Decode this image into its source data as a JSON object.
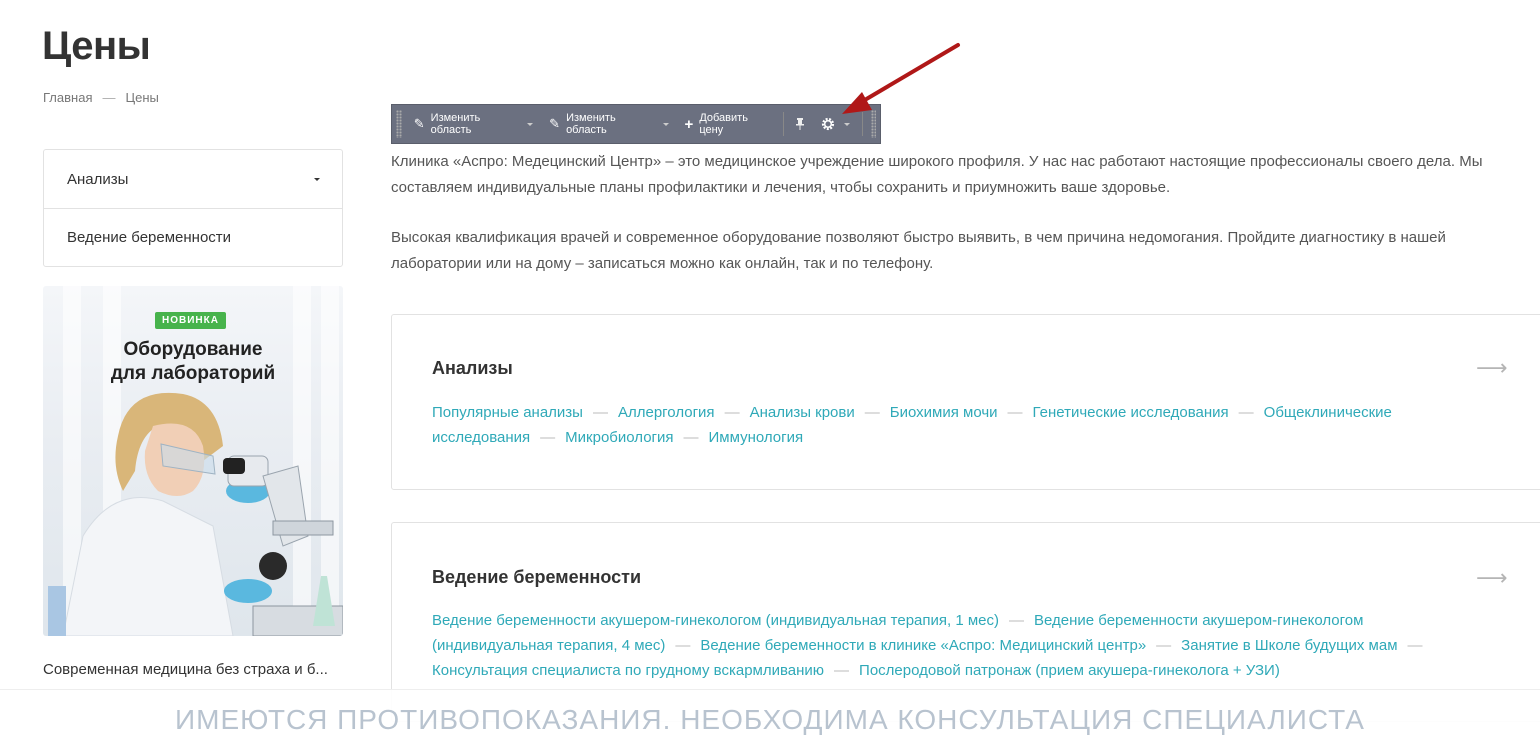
{
  "page": {
    "title": "Цены",
    "breadcrumb": [
      "Главная",
      "Цены"
    ],
    "breadcrumb_separator": "—"
  },
  "sidebar": {
    "menu": [
      {
        "label": "Анализы",
        "has_dropdown": true
      },
      {
        "label": "Ведение беременности",
        "has_dropdown": false
      }
    ],
    "banner": {
      "badge": "НОВИНКА",
      "title_line1": "Оборудование",
      "title_line2": "для лабораторий"
    },
    "text": "Современная медицина без страха и б..."
  },
  "toolbar": {
    "edit_area_1": "Изменить область",
    "edit_area_2": "Изменить область",
    "add_price": "Добавить цену",
    "icons": [
      "pencil-icon",
      "pencil-icon",
      "plus-icon",
      "pin-icon",
      "gear-icon"
    ]
  },
  "intro": {
    "paragraph1": "Клиника «Аспро: Медецинский Центр» – это медицинское учреждение широкого профиля. У нас нас работают настоящие профессионалы своего дела. Мы составляем индивидуальные планы профилактики и лечения, чтобы сохранить и приумножить ваше здоровье.",
    "paragraph2": "Высокая квалификация врачей и современное оборудование позволяют быстро выявить, в чем причина недомогания. Пройдите диагностику в нашей лаборатории или на дому – записаться можно как онлайн, так и по телефону."
  },
  "sections": [
    {
      "title": "Анализы",
      "links": [
        "Популярные анализы",
        "Аллергология",
        "Анализы крови",
        "Биохимия мочи",
        "Генетические исследования",
        "Общеклинические исследования",
        "Микробиология",
        "Иммунология"
      ]
    },
    {
      "title": "Ведение беременности",
      "links": [
        "Ведение беременности акушером-гинекологом (индивидуальная терапия, 1 мес)",
        "Ведение беременности акушером-гинекологом (индивидуальная терапия, 4 мес)",
        "Ведение беременности в клинике «Аспро: Медицинский центр»",
        "Занятие в Школе будущих мам",
        "Консультация специалиста по грудному вскармливанию",
        "Послеродовой патронаж (прием акушера-гинеколога + УЗИ)"
      ]
    }
  ],
  "footer_warning": "ИМЕЮТСЯ ПРОТИВОПОКАЗАНИЯ. НЕОБХОДИМА КОНСУЛЬТАЦИЯ СПЕЦИАЛИСТА",
  "colors": {
    "link": "#2fa9b8",
    "badge": "#47b34c",
    "toolbar": "#6b7080",
    "annotation_arrow": "#b01818"
  }
}
